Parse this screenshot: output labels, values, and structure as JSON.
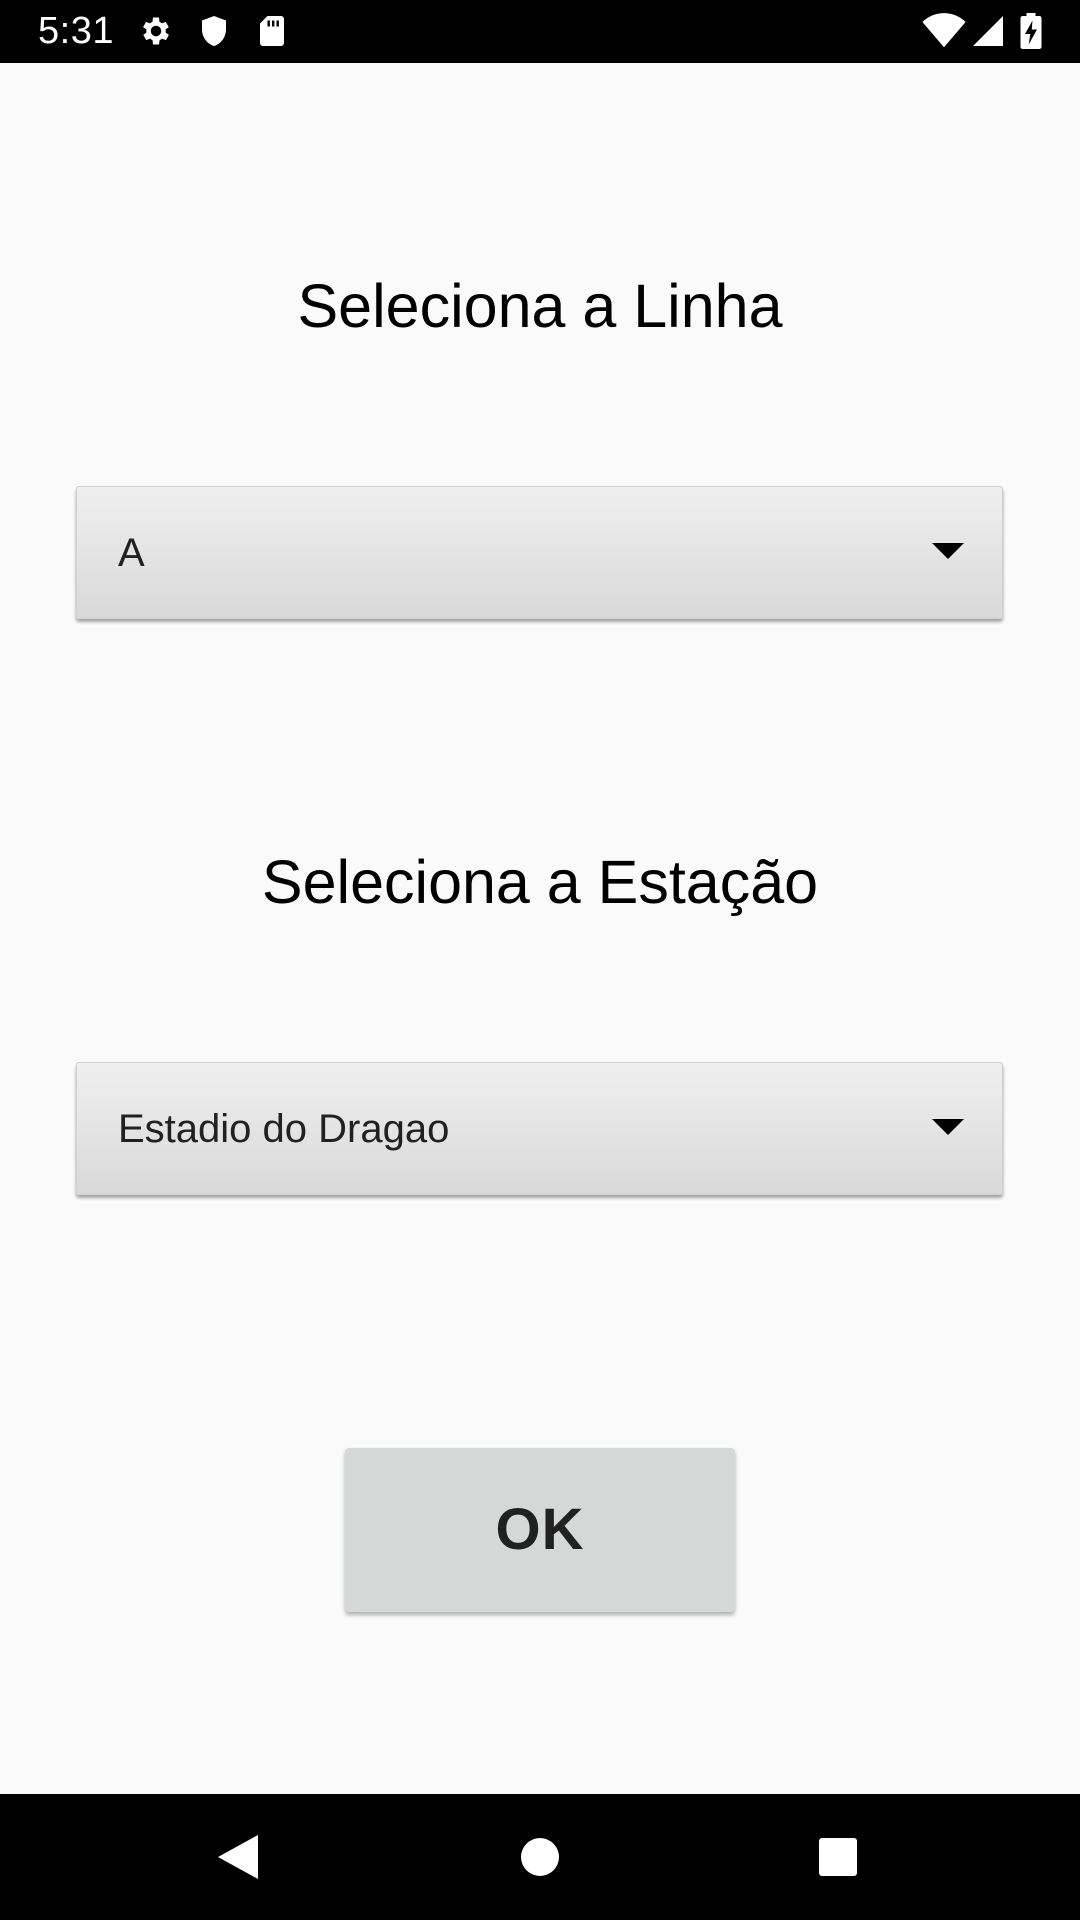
{
  "status_bar": {
    "time": "5:31",
    "left_icons": [
      "gear-icon",
      "shield-icon",
      "sd-card-icon"
    ],
    "right_icons": [
      "wifi-icon",
      "signal-icon",
      "battery-icon"
    ]
  },
  "line_section": {
    "title": "Seleciona a Linha",
    "selected_value": "A"
  },
  "station_section": {
    "title": "Seleciona a Estação",
    "selected_value": "Estadio do Dragao"
  },
  "ok_button": {
    "label": "OK"
  },
  "nav_bar": {
    "buttons": [
      "back-icon",
      "home-icon",
      "recents-icon"
    ]
  },
  "colors": {
    "background": "#fafafa",
    "bars": "#000000",
    "spinner_top": "#efefef",
    "spinner_bottom": "#d9d9d9",
    "button": "#d6d7d7",
    "text": "#212121"
  }
}
